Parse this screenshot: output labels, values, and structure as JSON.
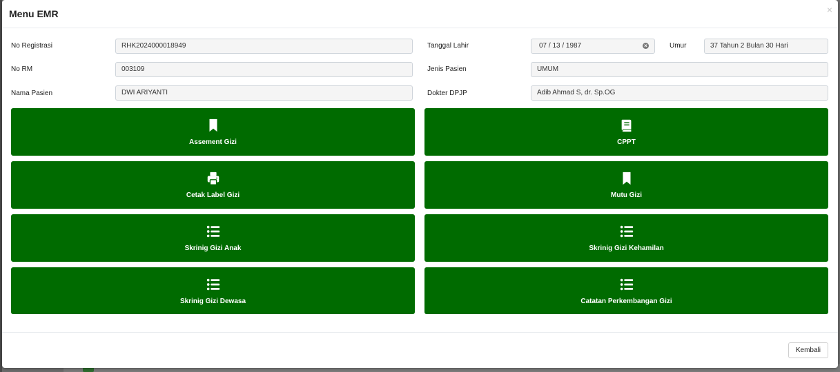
{
  "modal": {
    "title": "Menu EMR",
    "close_symbol": "×"
  },
  "form": {
    "no_registrasi": {
      "label": "No Registrasi",
      "value": "RHK2024000018949"
    },
    "no_rm": {
      "label": "No RM",
      "value": "003109"
    },
    "nama_pasien": {
      "label": "Nama Pasien",
      "value": "DWI ARIYANTI"
    },
    "tanggal_lahir": {
      "label": "Tanggal Lahir",
      "value": "07 / 13 / 1987"
    },
    "umur": {
      "label": "Umur",
      "value": "37 Tahun 2 Bulan 30 Hari"
    },
    "jenis_pasien": {
      "label": "Jenis Pasien",
      "value": "UMUM"
    },
    "dokter_dpjp": {
      "label": "Dokter DPJP",
      "value": "Adib Ahmad S, dr. Sp.OG"
    }
  },
  "menu": [
    {
      "label": "Assement Gizi",
      "icon": "bookmark-icon"
    },
    {
      "label": "CPPT",
      "icon": "book-icon"
    },
    {
      "label": "Cetak Label Gizi",
      "icon": "printer-icon"
    },
    {
      "label": "Mutu Gizi",
      "icon": "bookmark-icon"
    },
    {
      "label": "Skrinig Gizi Anak",
      "icon": "list-icon"
    },
    {
      "label": "Skrinig Gizi Kehamilan",
      "icon": "list-icon"
    },
    {
      "label": "Skrinig Gizi Dewasa",
      "icon": "list-icon"
    },
    {
      "label": "Catatan Perkembangan Gizi",
      "icon": "list-icon"
    }
  ],
  "footer": {
    "back_label": "Kembali"
  },
  "colors": {
    "button_green": "#006b00",
    "backdrop": "#6b6b6b"
  }
}
